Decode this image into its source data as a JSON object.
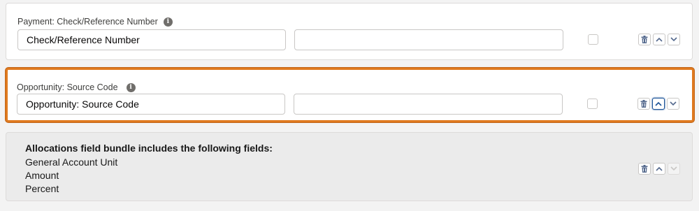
{
  "rows": [
    {
      "label": "Payment: Check/Reference Number",
      "source_value": "Check/Reference Number",
      "target_value": ""
    },
    {
      "label": "Opportunity: Source Code",
      "source_value": "Opportunity: Source Code",
      "target_value": ""
    }
  ],
  "bundle": {
    "title": "Allocations field bundle includes the following fields:",
    "fields": [
      "General Account Unit",
      "Amount",
      "Percent"
    ]
  },
  "icons": {
    "info": "info-icon",
    "delete": "trash-icon",
    "move_up": "chevron-up-icon",
    "move_down": "chevron-down-icon"
  },
  "colors": {
    "highlight_border": "#e07a1f",
    "focus": "#1b5297"
  }
}
